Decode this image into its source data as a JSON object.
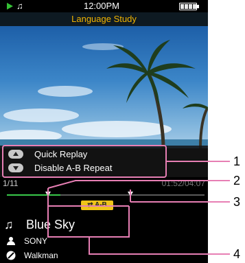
{
  "status_bar": {
    "play_icon": "play-icon",
    "music_icon": "music-note-icon",
    "note_glyph": "♫",
    "time": "12:00PM",
    "battery_icon": "battery-icon"
  },
  "app": {
    "title": "Language Study"
  },
  "album_art": {
    "icon": "palm-tree-beach-image"
  },
  "hints": {
    "up_label": "Quick Replay",
    "down_label": "Disable A-B Repeat"
  },
  "track": {
    "counter": "1/11",
    "time": "01:52/04:07",
    "progress": 0.27,
    "ab_badge": "⇄ A-B",
    "title": "Blue Sky",
    "title_icon": "music-note-icon",
    "title_glyph": "♫",
    "artist": "SONY",
    "artist_icon": "person-icon",
    "album": "Walkman",
    "album_icon": "disc-icon"
  },
  "callouts": {
    "n1": "1",
    "n2": "2",
    "n3": "3",
    "n4": "4"
  },
  "colors": {
    "accent_title": "#f2b400",
    "progress": "#39c94a",
    "callout_line": "#e77fb4",
    "ab_badge": "#f0c419"
  }
}
